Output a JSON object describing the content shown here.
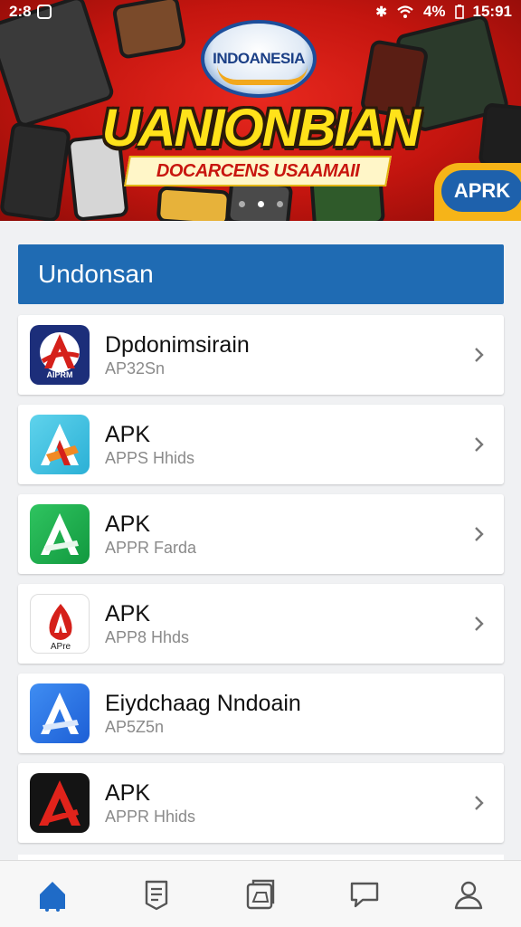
{
  "status_bar": {
    "time_left": "2:8",
    "battery": "4%",
    "clock": "15:91"
  },
  "banner": {
    "logo_text": "INDOANESIA",
    "headline": "UANIONBIAN",
    "subheadline": "DOCARCENS USAAMAII",
    "badge": "APRK",
    "slides": 3,
    "active_slide": 2
  },
  "section": {
    "title": "Undonsan"
  },
  "apps": [
    {
      "title": "Dpdonimsirain",
      "subtitle": "AP32Sn",
      "icon": "red-a-logo-navy-icon",
      "icon_label": "AIPRM"
    },
    {
      "title": "APK",
      "subtitle": "APPS Hhids",
      "icon": "a-logo-cyan-icon"
    },
    {
      "title": "APK",
      "subtitle": "APPR Farda",
      "icon": "a-logo-green-icon"
    },
    {
      "title": "APK",
      "subtitle": "APP8 Hhds",
      "icon": "red-drop-logo-icon",
      "icon_label": "APre"
    },
    {
      "title": "Eiydchaag Nndoain",
      "subtitle": "AP5Z5n",
      "icon": "a-logo-blue-icon"
    },
    {
      "title": "APK",
      "subtitle": "APPR Hhids",
      "icon": "red-a-logo-black-icon"
    }
  ],
  "colors": {
    "accent": "#1f6bb3",
    "banner_red": "#d21e16",
    "headline_yellow": "#ffe21a"
  },
  "bottom_nav": [
    {
      "name": "home-icon",
      "active": true
    },
    {
      "name": "bookmark-list-icon"
    },
    {
      "name": "documents-icon"
    },
    {
      "name": "chat-icon"
    },
    {
      "name": "profile-icon"
    }
  ]
}
